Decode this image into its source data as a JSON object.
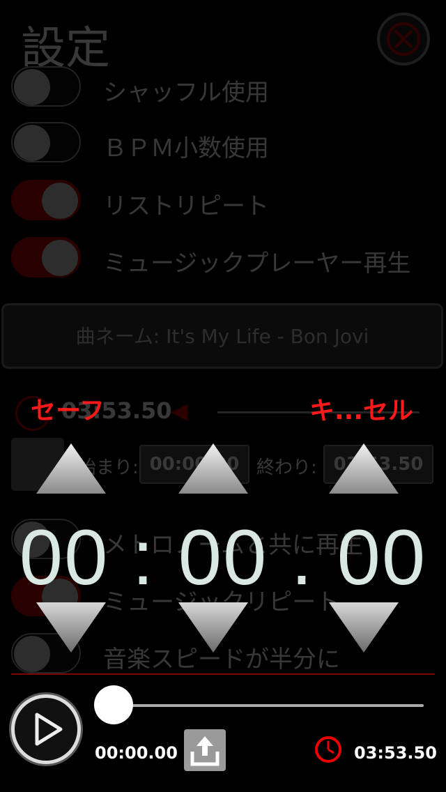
{
  "header": {
    "title": "設定"
  },
  "settings": {
    "rows": [
      {
        "label": "シャッフル使用",
        "on": false
      },
      {
        "label": "ＢＰＭ小数使用",
        "on": false
      },
      {
        "label": "リストリピート",
        "on": true
      },
      {
        "label": "ミュージックプレーヤー再生",
        "on": true
      }
    ],
    "song_label": "曲ネーム: It's My Life - Bon Jovi",
    "duration": "03:53.50",
    "start_label": "始まり:",
    "start_value": "00:00.00",
    "end_label": "終わり:",
    "end_value": "03:53.50",
    "lower_rows": [
      {
        "label": "メトロノームと共に再生",
        "on": false
      },
      {
        "label": "ミュージックリピート",
        "on": true
      },
      {
        "label": "音楽スピードが半分に",
        "on": false
      }
    ]
  },
  "picker": {
    "save_label": "セーフ",
    "cancel_label": "キ...セル",
    "digits": "00 : 00 . 00"
  },
  "player": {
    "position": 0.0,
    "current_time": "00:00.00",
    "total_time": "03:53.50"
  },
  "colors": {
    "accent_red": "#ff1a1a",
    "digit_color": "#d9e8e2"
  },
  "icons": [
    "close-icon",
    "speaker-icon",
    "play-icon",
    "share-icon",
    "clock-icon"
  ]
}
